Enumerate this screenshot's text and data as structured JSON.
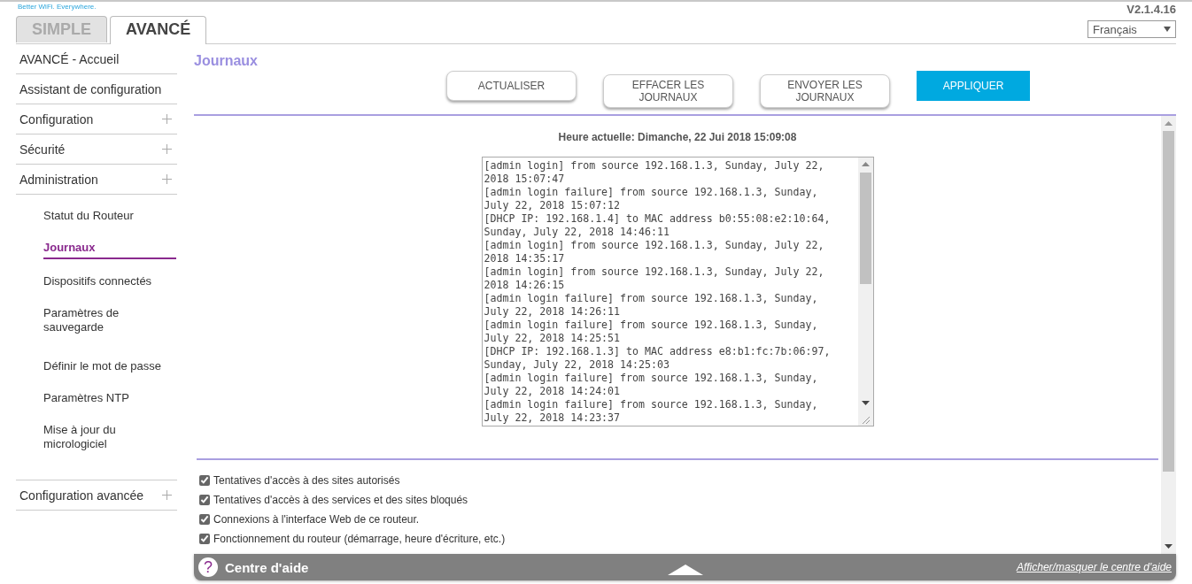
{
  "brand": {
    "tagline": "Better WiFi. Everywhere."
  },
  "version": "V2.1.4.16",
  "language": {
    "value": "Français"
  },
  "tabs": [
    {
      "label": "SIMPLE",
      "selected": false
    },
    {
      "label": "AVANCÉ",
      "selected": true
    }
  ],
  "sidebar": {
    "items": [
      {
        "label": "AVANCÉ - Accueil",
        "expandable": false
      },
      {
        "label": "Assistant de configuration",
        "expandable": false
      },
      {
        "label": "Configuration",
        "expandable": true
      },
      {
        "label": "Sécurité",
        "expandable": true
      },
      {
        "label": "Administration",
        "expandable": true,
        "children": [
          {
            "label": "Statut du Routeur",
            "selected": false
          },
          {
            "label": "Journaux",
            "selected": true
          },
          {
            "label": "Dispositifs connectés",
            "selected": false
          },
          {
            "label": "Paramètres de sauvegarde",
            "selected": false
          },
          {
            "label": "Définir le mot de passe",
            "selected": false
          },
          {
            "label": "Paramètres NTP",
            "selected": false
          },
          {
            "label": "Mise à jour du micrologiciel",
            "selected": false
          }
        ]
      },
      {
        "label": "Configuration avancée",
        "expandable": true
      }
    ]
  },
  "page": {
    "title": "Journaux",
    "buttons": [
      {
        "label": "ACTUALISER",
        "kind": "secondary"
      },
      {
        "label": "EFFACER LES JOURNAUX",
        "kind": "secondary"
      },
      {
        "label": "ENVOYER LES JOURNAUX",
        "kind": "secondary"
      },
      {
        "label": "APPLIQUER",
        "kind": "primary"
      }
    ],
    "current_time": "Heure actuelle: Dimanche, 22 Jui 2018 15:09:08",
    "log": [
      "[admin login] from source 192.168.1.3, Sunday, July 22, 2018 15:07:47",
      "[admin login failure] from source 192.168.1.3, Sunday, July 22, 2018 15:07:12",
      "[DHCP IP: 192.168.1.4] to MAC address b0:55:08:e2:10:64, Sunday, July 22, 2018 14:46:11",
      "[admin login] from source 192.168.1.3, Sunday, July 22, 2018 14:35:17",
      "[admin login] from source 192.168.1.3, Sunday, July 22, 2018 14:26:15",
      "[admin login failure] from source 192.168.1.3, Sunday, July 22, 2018 14:26:11",
      "[admin login failure] from source 192.168.1.3, Sunday, July 22, 2018 14:25:51",
      "[DHCP IP: 192.168.1.3] to MAC address e8:b1:fc:7b:06:97, Sunday, July 22, 2018 14:25:03",
      "[admin login failure] from source 192.168.1.3, Sunday, July 22, 2018 14:24:01",
      "[admin login failure] from source 192.168.1.3, Sunday, July 22, 2018 14:23:37"
    ],
    "options": [
      {
        "label": "Tentatives d'accès à des sites autorisés",
        "checked": true
      },
      {
        "label": "Tentatives d'accès à des services et des sites bloqués",
        "checked": true
      },
      {
        "label": "Connexions à l'interface Web de ce routeur.",
        "checked": true
      },
      {
        "label": "Fonctionnement du routeur (démarrage, heure d'écriture, etc.)",
        "checked": true
      }
    ]
  },
  "help_bar": {
    "icon_text": "?",
    "title": "Centre d'aide",
    "link": "Afficher/masquer le centre d'aide"
  }
}
